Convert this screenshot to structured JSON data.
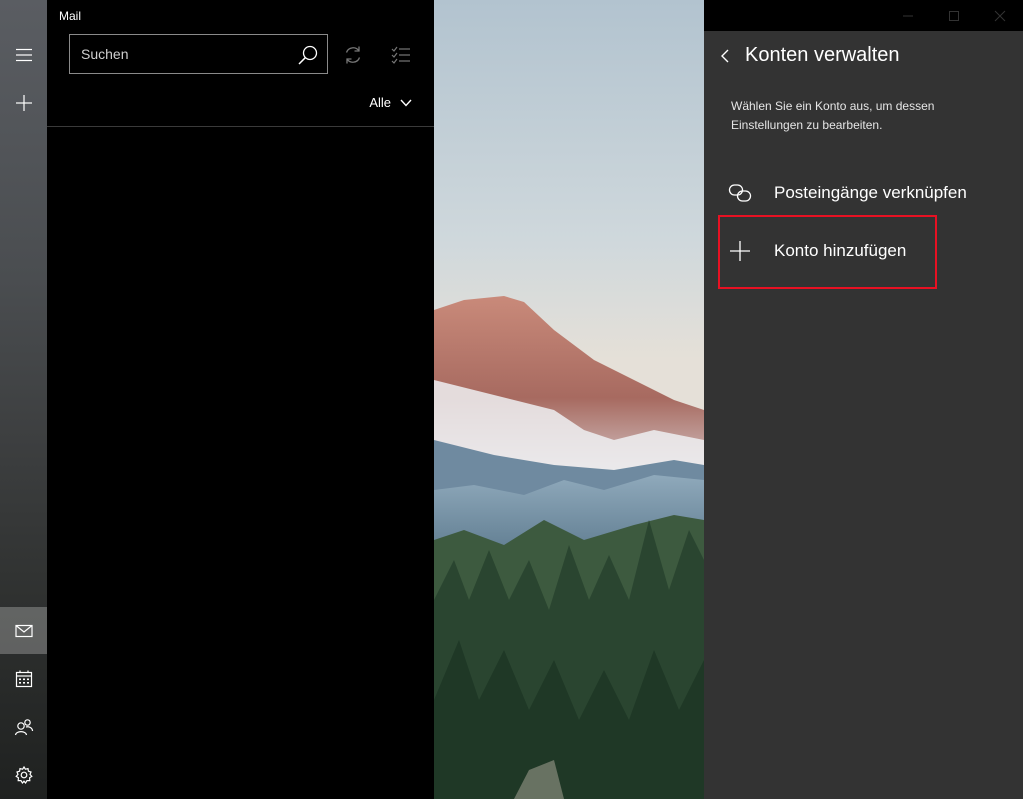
{
  "app": {
    "title": "Mail"
  },
  "search": {
    "placeholder": "Suchen"
  },
  "filter": {
    "label": "Alle"
  },
  "rail": {
    "items": [
      {
        "icon": "hamburger-icon"
      },
      {
        "icon": "compose-icon"
      },
      {
        "icon": "mail-icon",
        "active": true
      },
      {
        "icon": "calendar-icon"
      },
      {
        "icon": "people-icon"
      },
      {
        "icon": "settings-icon"
      }
    ]
  },
  "toolbar": {
    "sync_icon": "sync-icon",
    "select_icon": "select-mode-icon"
  },
  "flyout": {
    "title": "Konten verwalten",
    "description": "Wählen Sie ein Konto aus, um dessen Einstellungen zu bearbeiten.",
    "items": [
      {
        "label": "Posteingänge verknüpfen",
        "icon": "link-icon"
      },
      {
        "label": "Konto hinzufügen",
        "icon": "add-icon"
      }
    ]
  },
  "colors": {
    "flyout_bg": "#333333",
    "highlight": "#e81123"
  }
}
